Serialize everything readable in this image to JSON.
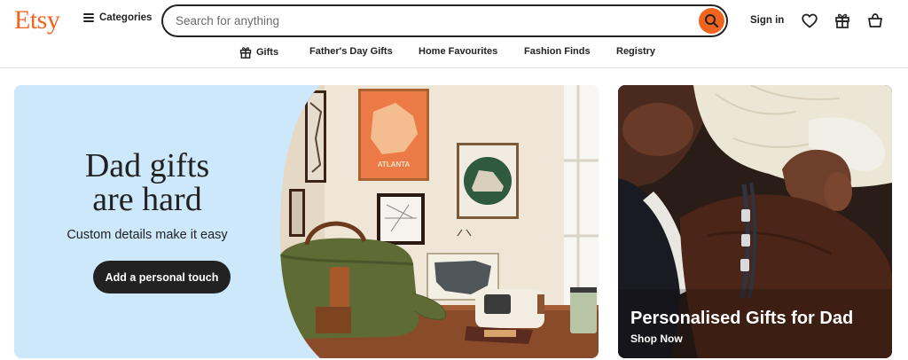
{
  "header": {
    "logo": "Etsy",
    "categories_label": "Categories",
    "search_placeholder": "Search for anything",
    "sign_in_label": "Sign in",
    "icons": [
      "favorites-heart-icon",
      "gift-icon",
      "cart-icon"
    ]
  },
  "nav": {
    "items": [
      {
        "label": "Gifts",
        "icon": "gift-icon"
      },
      {
        "label": "Father's Day Gifts"
      },
      {
        "label": "Home Favourites"
      },
      {
        "label": "Fashion Finds"
      },
      {
        "label": "Registry"
      }
    ]
  },
  "hero": {
    "title": "Dad gifts\nare hard",
    "subtitle": "Custom details make it easy",
    "button_label": "Add a personal touch",
    "poster_text": "ATLANTA"
  },
  "side_promo": {
    "title": "Personalised Gifts for Dad",
    "link_label": "Shop Now"
  },
  "colors": {
    "brand": "#f1641e",
    "hero_bg": "#cde7fb",
    "text": "#222222"
  }
}
